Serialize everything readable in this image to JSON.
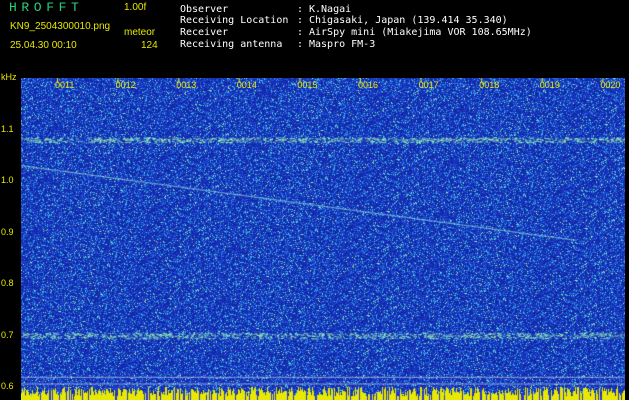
{
  "header": {
    "logo": "HROFFT",
    "version": "1.00f",
    "filename": "KN9_2504300010.png",
    "datetime": "25.04.30 00:10",
    "meteor_label": "meteor",
    "meteor_count": "124"
  },
  "info": [
    {
      "label": "Observer",
      "value": "K.Nagai"
    },
    {
      "label": "Receiving Location",
      "value": "Chigasaki, Japan (139.414 35.340)"
    },
    {
      "label": "Receiver",
      "value": "AirSpy mini (Miakejima VOR 108.65MHz)"
    },
    {
      "label": "Receiving antenna",
      "value": "Maspro FM-3"
    }
  ],
  "colors": {
    "background": "#000000",
    "label_yellow": "#e8e800",
    "logo_green": "#2ad07a",
    "spectrogram_blue": "#1a2fb8"
  },
  "chart_data": {
    "type": "heatmap",
    "title": "",
    "xlabel": "",
    "ylabel": "kHz",
    "ylim": [
      0.575,
      1.2
    ],
    "y_ticks": [
      "1.1",
      "1.0",
      "0.9",
      "0.8",
      "0.7",
      "0.6"
    ],
    "x_ticks": [
      "0011",
      "0012",
      "0013",
      "0014",
      "0015",
      "0016",
      "0017",
      "0018",
      "0019",
      "0020"
    ]
  }
}
